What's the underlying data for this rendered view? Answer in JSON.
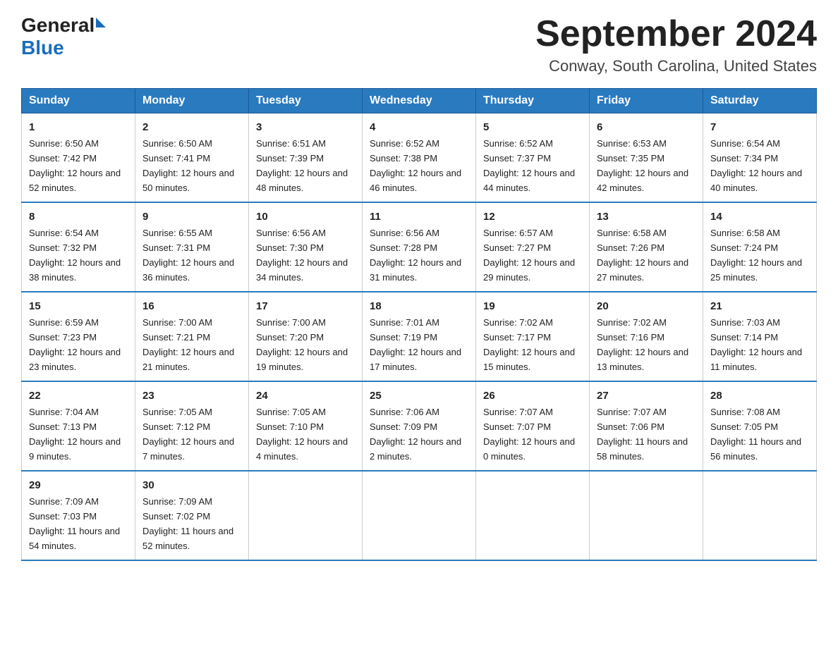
{
  "logo": {
    "general": "General",
    "blue": "Blue"
  },
  "title": "September 2024",
  "location": "Conway, South Carolina, United States",
  "days_of_week": [
    "Sunday",
    "Monday",
    "Tuesday",
    "Wednesday",
    "Thursday",
    "Friday",
    "Saturday"
  ],
  "weeks": [
    [
      {
        "day": "1",
        "sunrise": "6:50 AM",
        "sunset": "7:42 PM",
        "daylight": "12 hours and 52 minutes."
      },
      {
        "day": "2",
        "sunrise": "6:50 AM",
        "sunset": "7:41 PM",
        "daylight": "12 hours and 50 minutes."
      },
      {
        "day": "3",
        "sunrise": "6:51 AM",
        "sunset": "7:39 PM",
        "daylight": "12 hours and 48 minutes."
      },
      {
        "day": "4",
        "sunrise": "6:52 AM",
        "sunset": "7:38 PM",
        "daylight": "12 hours and 46 minutes."
      },
      {
        "day": "5",
        "sunrise": "6:52 AM",
        "sunset": "7:37 PM",
        "daylight": "12 hours and 44 minutes."
      },
      {
        "day": "6",
        "sunrise": "6:53 AM",
        "sunset": "7:35 PM",
        "daylight": "12 hours and 42 minutes."
      },
      {
        "day": "7",
        "sunrise": "6:54 AM",
        "sunset": "7:34 PM",
        "daylight": "12 hours and 40 minutes."
      }
    ],
    [
      {
        "day": "8",
        "sunrise": "6:54 AM",
        "sunset": "7:32 PM",
        "daylight": "12 hours and 38 minutes."
      },
      {
        "day": "9",
        "sunrise": "6:55 AM",
        "sunset": "7:31 PM",
        "daylight": "12 hours and 36 minutes."
      },
      {
        "day": "10",
        "sunrise": "6:56 AM",
        "sunset": "7:30 PM",
        "daylight": "12 hours and 34 minutes."
      },
      {
        "day": "11",
        "sunrise": "6:56 AM",
        "sunset": "7:28 PM",
        "daylight": "12 hours and 31 minutes."
      },
      {
        "day": "12",
        "sunrise": "6:57 AM",
        "sunset": "7:27 PM",
        "daylight": "12 hours and 29 minutes."
      },
      {
        "day": "13",
        "sunrise": "6:58 AM",
        "sunset": "7:26 PM",
        "daylight": "12 hours and 27 minutes."
      },
      {
        "day": "14",
        "sunrise": "6:58 AM",
        "sunset": "7:24 PM",
        "daylight": "12 hours and 25 minutes."
      }
    ],
    [
      {
        "day": "15",
        "sunrise": "6:59 AM",
        "sunset": "7:23 PM",
        "daylight": "12 hours and 23 minutes."
      },
      {
        "day": "16",
        "sunrise": "7:00 AM",
        "sunset": "7:21 PM",
        "daylight": "12 hours and 21 minutes."
      },
      {
        "day": "17",
        "sunrise": "7:00 AM",
        "sunset": "7:20 PM",
        "daylight": "12 hours and 19 minutes."
      },
      {
        "day": "18",
        "sunrise": "7:01 AM",
        "sunset": "7:19 PM",
        "daylight": "12 hours and 17 minutes."
      },
      {
        "day": "19",
        "sunrise": "7:02 AM",
        "sunset": "7:17 PM",
        "daylight": "12 hours and 15 minutes."
      },
      {
        "day": "20",
        "sunrise": "7:02 AM",
        "sunset": "7:16 PM",
        "daylight": "12 hours and 13 minutes."
      },
      {
        "day": "21",
        "sunrise": "7:03 AM",
        "sunset": "7:14 PM",
        "daylight": "12 hours and 11 minutes."
      }
    ],
    [
      {
        "day": "22",
        "sunrise": "7:04 AM",
        "sunset": "7:13 PM",
        "daylight": "12 hours and 9 minutes."
      },
      {
        "day": "23",
        "sunrise": "7:05 AM",
        "sunset": "7:12 PM",
        "daylight": "12 hours and 7 minutes."
      },
      {
        "day": "24",
        "sunrise": "7:05 AM",
        "sunset": "7:10 PM",
        "daylight": "12 hours and 4 minutes."
      },
      {
        "day": "25",
        "sunrise": "7:06 AM",
        "sunset": "7:09 PM",
        "daylight": "12 hours and 2 minutes."
      },
      {
        "day": "26",
        "sunrise": "7:07 AM",
        "sunset": "7:07 PM",
        "daylight": "12 hours and 0 minutes."
      },
      {
        "day": "27",
        "sunrise": "7:07 AM",
        "sunset": "7:06 PM",
        "daylight": "11 hours and 58 minutes."
      },
      {
        "day": "28",
        "sunrise": "7:08 AM",
        "sunset": "7:05 PM",
        "daylight": "11 hours and 56 minutes."
      }
    ],
    [
      {
        "day": "29",
        "sunrise": "7:09 AM",
        "sunset": "7:03 PM",
        "daylight": "11 hours and 54 minutes."
      },
      {
        "day": "30",
        "sunrise": "7:09 AM",
        "sunset": "7:02 PM",
        "daylight": "11 hours and 52 minutes."
      },
      null,
      null,
      null,
      null,
      null
    ]
  ]
}
